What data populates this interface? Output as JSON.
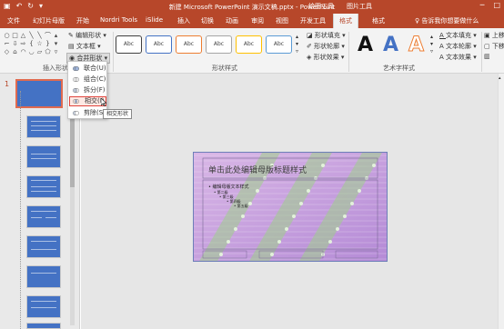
{
  "titlebar": {
    "title": "新建 Microsoft PowerPoint 演示文稿.pptx - PowerPoint",
    "ctx_drawing": "绘图工具",
    "ctx_picture": "图片工具"
  },
  "tabs": [
    "文件",
    "幻灯片母版",
    "开始",
    "Nordri Tools",
    "iSlide",
    "插入",
    "切换",
    "动画",
    "审阅",
    "视图",
    "开发工具",
    "格式",
    "格式"
  ],
  "tellme": "告诉我你想要做什么",
  "ribbon": {
    "insert_shapes_label": "插入形状",
    "edit_shape": "编辑形状",
    "text_box": "文本框",
    "merge_shapes": "合并形状",
    "swatch_text": "Abc",
    "shape_styles_label": "形状样式",
    "shape_fill": "形状填充",
    "shape_outline": "形状轮廓",
    "shape_effects": "形状效果",
    "wordart_label": "艺术字样式",
    "wordart_glyph": "A",
    "text_fill": "文本填充",
    "text_outline": "文本轮廓",
    "text_effects": "文本效果",
    "move_up": "上移",
    "move_down": "下移",
    "colors": {
      "accent": "#b7472a",
      "wordart_blue": "#4472c4",
      "wordart_orange": "#ed7d31"
    }
  },
  "merge_menu": {
    "items": [
      "联合(U)",
      "组合(C)",
      "拆分(F)",
      "相交(I)",
      "剪除(S)"
    ],
    "highlighted": "相交(I)",
    "tooltip": "相交形状"
  },
  "sidebar": {
    "active_slide_number": "1"
  },
  "slide": {
    "title": "单击此处编辑母版标题样式",
    "bullets": [
      "• 编辑母版文本样式",
      "• 第二级",
      "• 第三级",
      "• 第四级",
      "• 第五级"
    ]
  }
}
